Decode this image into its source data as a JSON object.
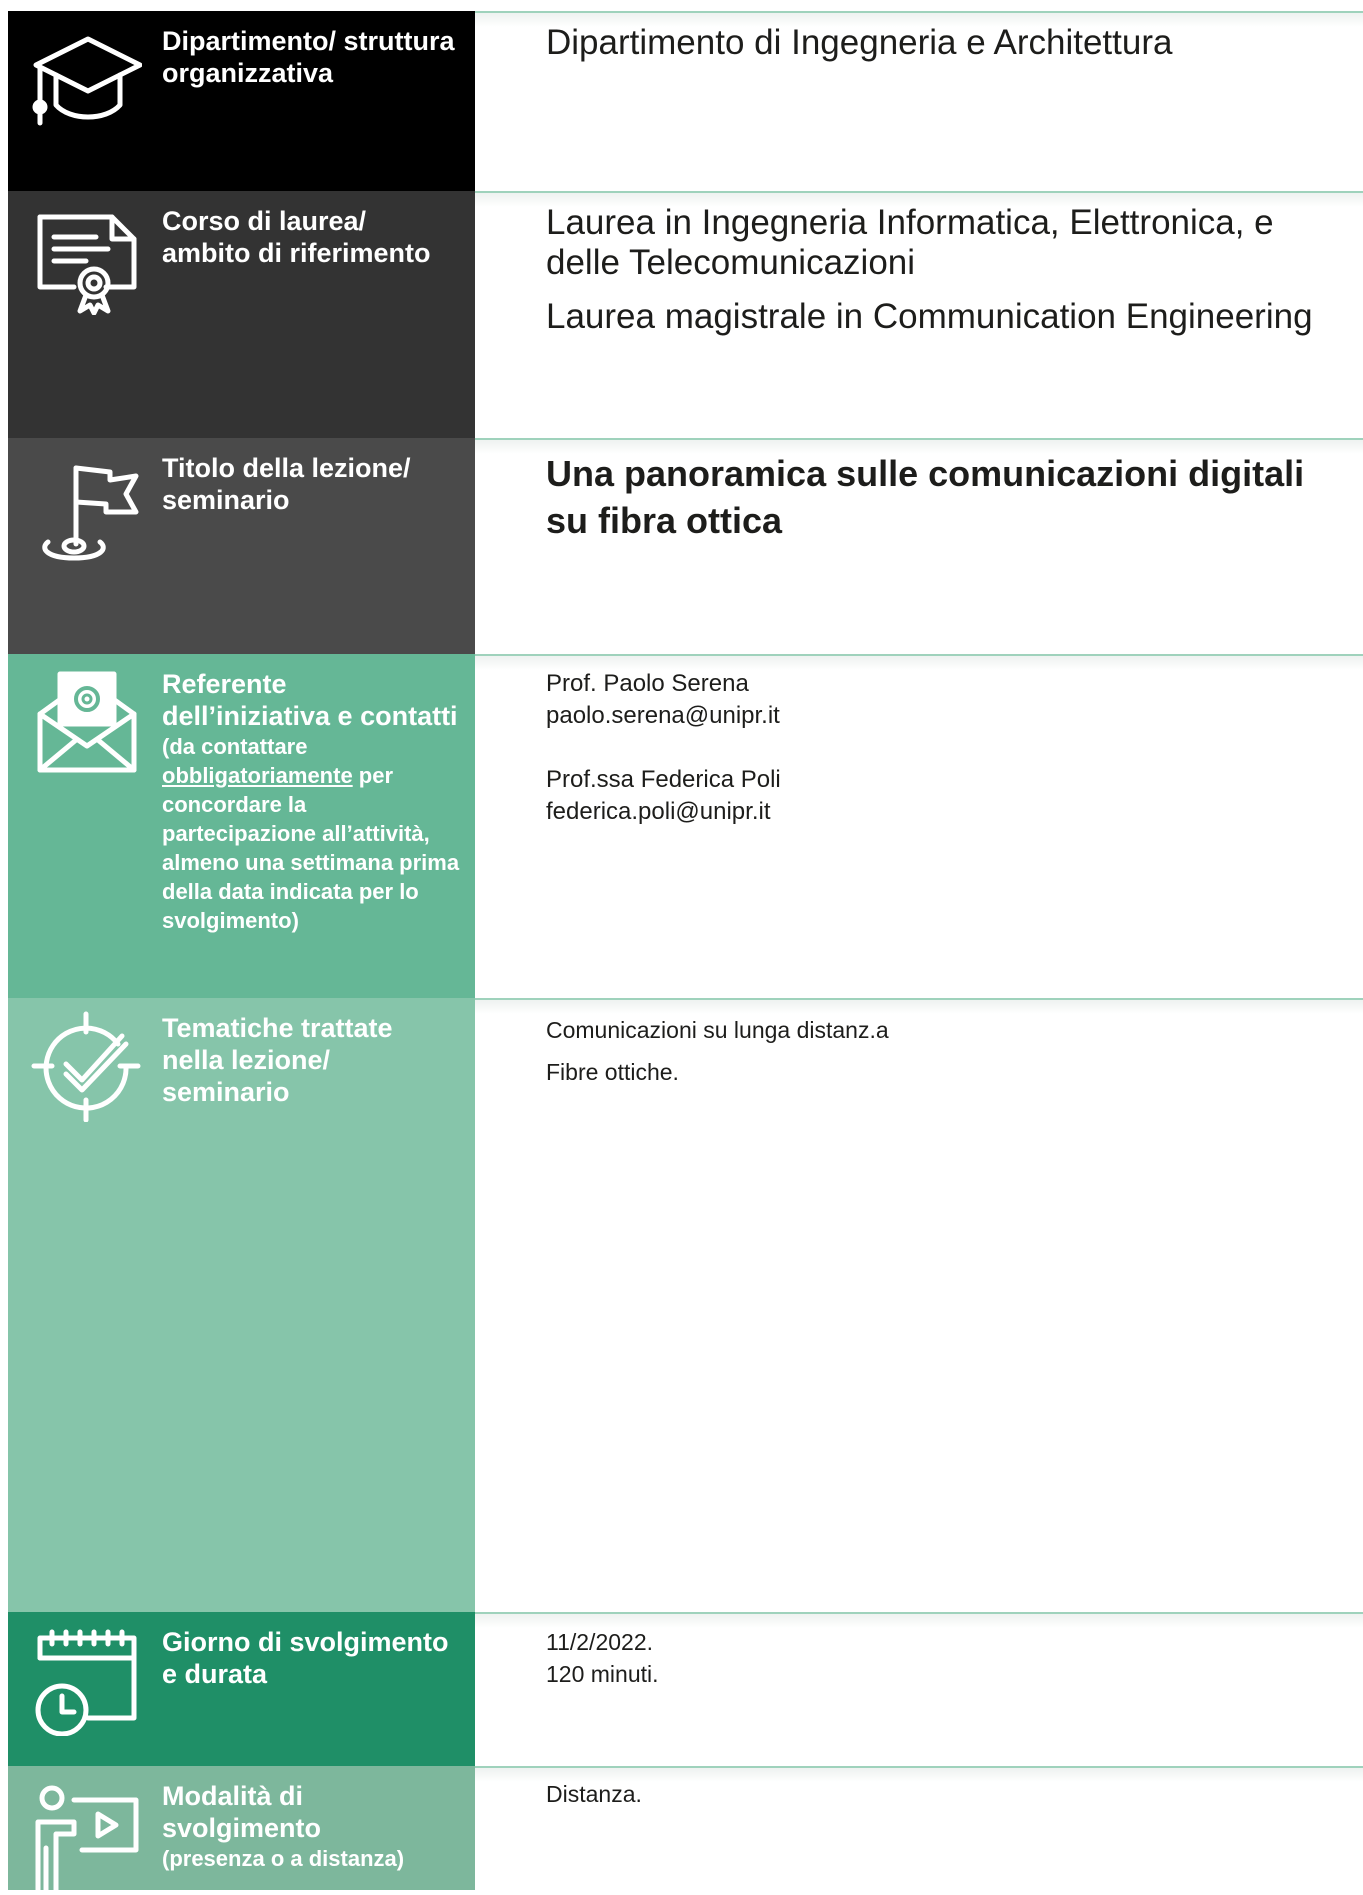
{
  "colors": {
    "row1": "#000000",
    "row2": "#333333",
    "row3": "#4a4a4a",
    "row4": "#65b796",
    "row5": "#86c5aa",
    "row6": "#1f8f67",
    "row7": "#7db79c"
  },
  "rows": [
    {
      "icon": "graduation-cap-icon",
      "label": "Dipartimento/ struttura organizzativa",
      "value": "Dipartimento di Ingegneria e Architettura"
    },
    {
      "icon": "certificate-icon",
      "label": "Corso di laurea/ ambito di riferimento",
      "values": [
        "Laurea in Ingegneria Informatica, Elettronica, e delle Telecomunicazioni",
        "Laurea magistrale in Communication Engineering"
      ]
    },
    {
      "icon": "flag-target-icon",
      "label": "Titolo della lezione/ seminario",
      "value": "Una panoramica sulle comunicazioni digitali su fibra ottica"
    },
    {
      "icon": "email-envelope-icon",
      "label": "Referente dell’iniziativa e contatti",
      "sub_before": "(da contattare ",
      "sub_underlined": "obbligatoriamente",
      "sub_after": " per concordare la partecipazione all’attività, almeno una settimana prima della data indicata per lo svolgimento)",
      "contacts": [
        {
          "name": "Prof. Paolo Serena",
          "email": "paolo.serena@unipr.it"
        },
        {
          "name": "Prof.ssa Federica Poli",
          "email": "federica.poli@unipr.it"
        }
      ]
    },
    {
      "icon": "target-check-icon",
      "label": "Tematiche trattate nella lezione/ seminario",
      "values": [
        "Comunicazioni su lunga distanz.a",
        "Fibre ottiche."
      ]
    },
    {
      "icon": "calendar-clock-icon",
      "label": "Giorno di svolgimento e durata",
      "lines": [
        "11/2/2022.",
        "120 minuti."
      ]
    },
    {
      "icon": "presenter-screen-icon",
      "label": "Modalità di svolgimento",
      "sub": "(presenza o a distanza)",
      "value": "Distanza."
    }
  ]
}
